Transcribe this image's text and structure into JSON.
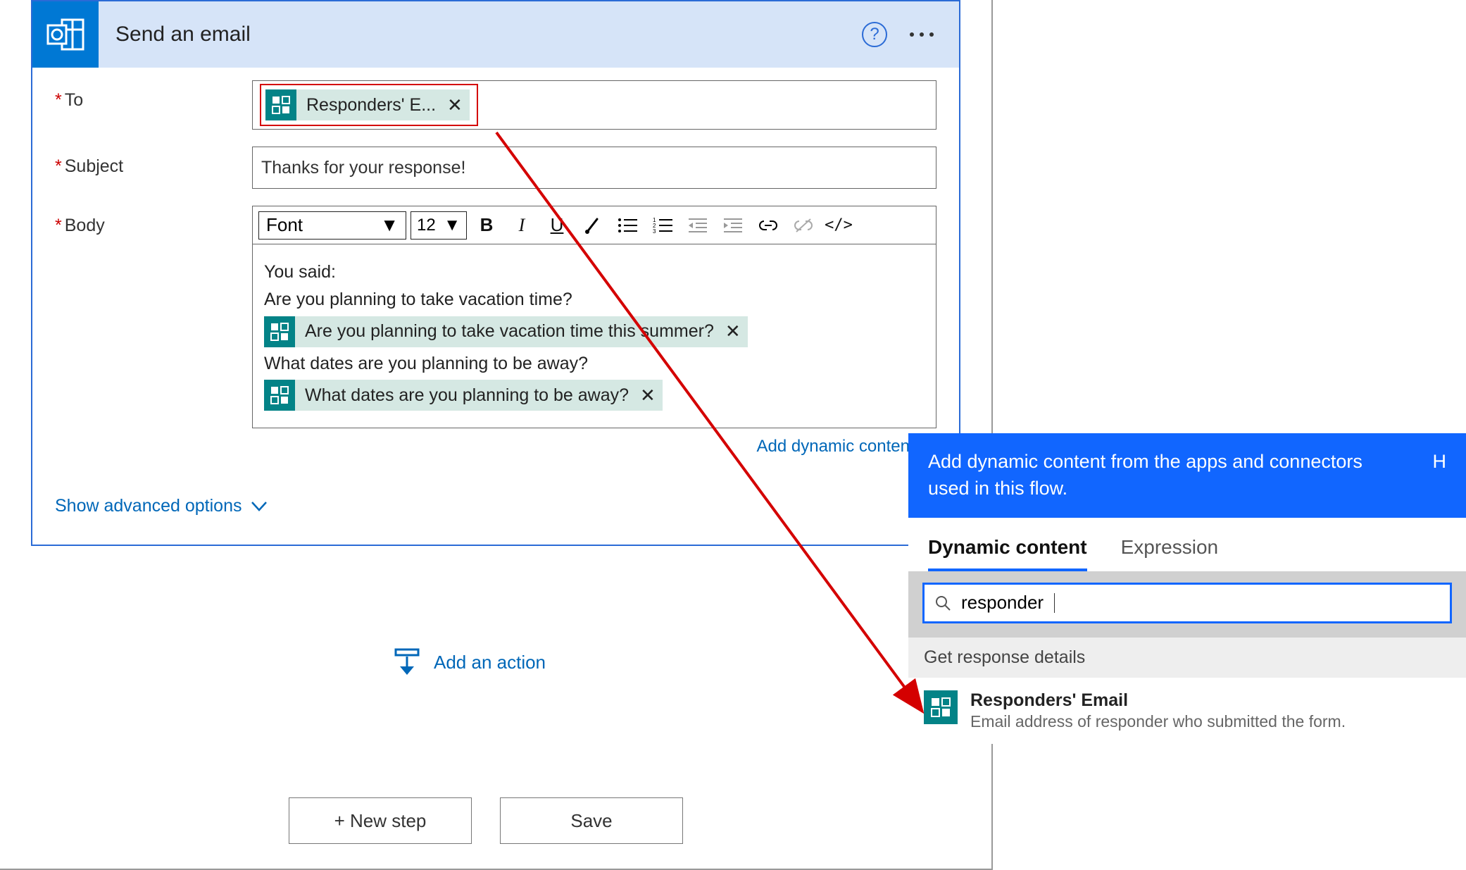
{
  "card": {
    "title": "Send an email",
    "help_label": "?",
    "fields": {
      "to": {
        "label": "To",
        "required": true,
        "token": "Responders' E..."
      },
      "subject": {
        "label": "Subject",
        "required": true,
        "value": "Thanks for your response!"
      },
      "body": {
        "label": "Body",
        "required": true,
        "font_label": "Font",
        "size_value": "12",
        "line1": "You said:",
        "line2": "Are you planning to take vacation time?",
        "token1": "Are you planning to take vacation time this summer?",
        "line3": "What dates are you planning to be away?",
        "token2": "What dates are you planning to be away?"
      }
    },
    "add_dynamic_content": "Add dynamic content",
    "show_advanced": "Show advanced options"
  },
  "add_action": "Add an action",
  "footer": {
    "new_step": "+ New step",
    "save": "Save"
  },
  "dynamic": {
    "heading": "Add dynamic content from the apps and connectors used in this flow.",
    "hide": "H",
    "tab_dynamic": "Dynamic content",
    "tab_expression": "Expression",
    "search_value": "responder",
    "section": "Get response details",
    "result_title": "Responders' Email",
    "result_sub": "Email address of responder who submitted the form."
  }
}
